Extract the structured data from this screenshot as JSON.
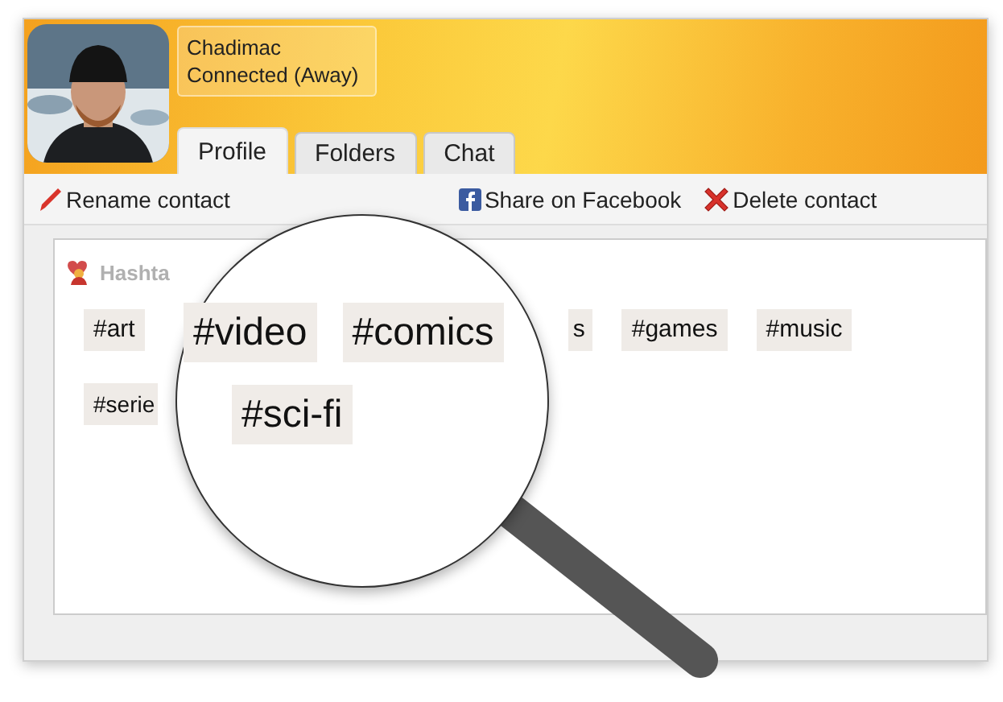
{
  "contact": {
    "name": "Chadimac",
    "status": "Connected (Away)"
  },
  "tabs": [
    {
      "label": "Profile",
      "selected": true
    },
    {
      "label": "Folders",
      "selected": false
    },
    {
      "label": "Chat",
      "selected": false
    }
  ],
  "toolbar": [
    {
      "label": "Rename contact",
      "kind": "rename"
    },
    {
      "label": "Share on Facebook",
      "kind": "facebook"
    },
    {
      "label": "Delete contact",
      "kind": "delete"
    }
  ],
  "hashtags": {
    "title": "Hashta",
    "rows": [
      [
        {
          "text": "#art",
          "kind": "whole"
        },
        {
          "text": "s",
          "kind": "cut-left"
        },
        {
          "text": "#games",
          "kind": "whole"
        },
        {
          "text": "#music",
          "kind": "whole"
        }
      ],
      [
        {
          "text": "#serie",
          "kind": "cut-right"
        }
      ]
    ]
  },
  "magnifier": {
    "rows": [
      [
        "#video",
        "#comics"
      ],
      [
        "#sci-fi"
      ]
    ]
  }
}
